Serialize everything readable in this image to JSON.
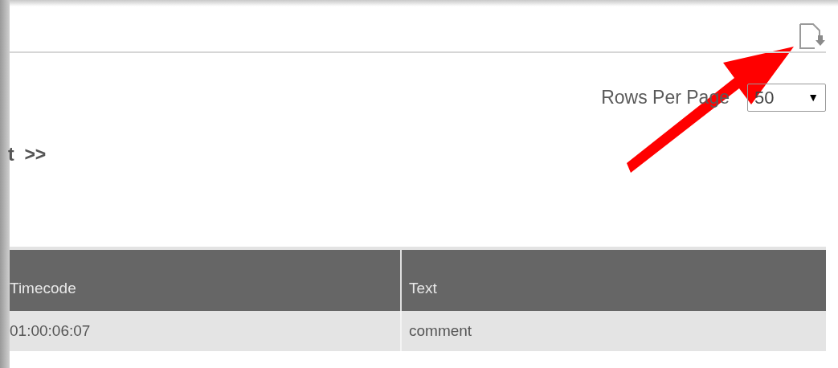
{
  "pagination": {
    "rows_per_page_label": "Rows Per Page",
    "rows_per_page": "50",
    "dropdown_caret": "▼",
    "next_link": "t  >>"
  },
  "table": {
    "columns": [
      "Timecode",
      "Text"
    ],
    "rows": [
      [
        "01:00:06:07",
        "comment"
      ]
    ]
  },
  "annotation": {
    "kind": "arrow"
  }
}
